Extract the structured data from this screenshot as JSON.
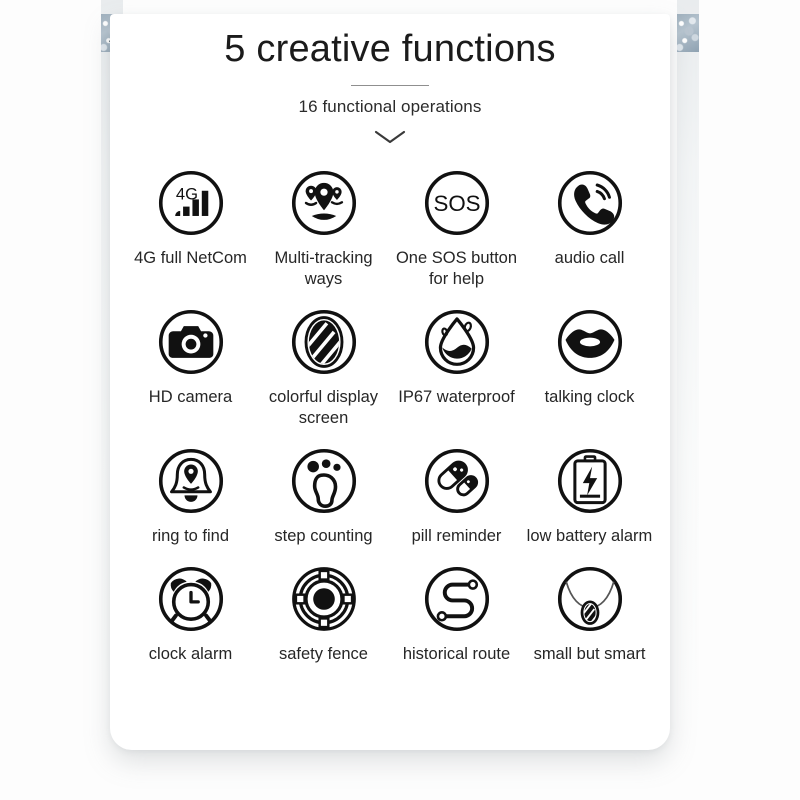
{
  "header": {
    "title": "5 creative functions",
    "subtitle": "16 functional operations",
    "chevron_icon": "chevron-down-icon"
  },
  "theme": {
    "card_background": "#ffffff",
    "page_background": "#fdfdfd",
    "title_color": "#1b1b1b",
    "label_color": "#262626",
    "icon_color": "#111111",
    "divider_color": "#8f8f8f",
    "rail_color": "#e9ecee",
    "rail_cap_color": "#9fb0bd"
  },
  "features": [
    {
      "label": "4G full NetCom",
      "icon": "signal-4g-icon"
    },
    {
      "label": "Multi-tracking ways",
      "icon": "map-pins-icon"
    },
    {
      "label": "One SOS button for help",
      "icon": "sos-icon"
    },
    {
      "label": "audio call",
      "icon": "phone-call-icon"
    },
    {
      "label": "HD camera",
      "icon": "camera-icon"
    },
    {
      "label": "colorful display screen",
      "icon": "display-oval-icon"
    },
    {
      "label": "IP67 waterproof",
      "icon": "water-drop-icon"
    },
    {
      "label": "talking clock",
      "icon": "lips-icon"
    },
    {
      "label": "ring to find",
      "icon": "bell-pin-icon"
    },
    {
      "label": "step counting",
      "icon": "footprint-icon"
    },
    {
      "label": "pill reminder",
      "icon": "pills-icon"
    },
    {
      "label": "low battery alarm",
      "icon": "battery-bolt-icon"
    },
    {
      "label": "clock alarm",
      "icon": "alarm-clock-icon"
    },
    {
      "label": "safety fence",
      "icon": "safety-fence-icon"
    },
    {
      "label": "historical route",
      "icon": "route-path-icon"
    },
    {
      "label": "small but smart",
      "icon": "necklace-pendant-icon"
    }
  ]
}
